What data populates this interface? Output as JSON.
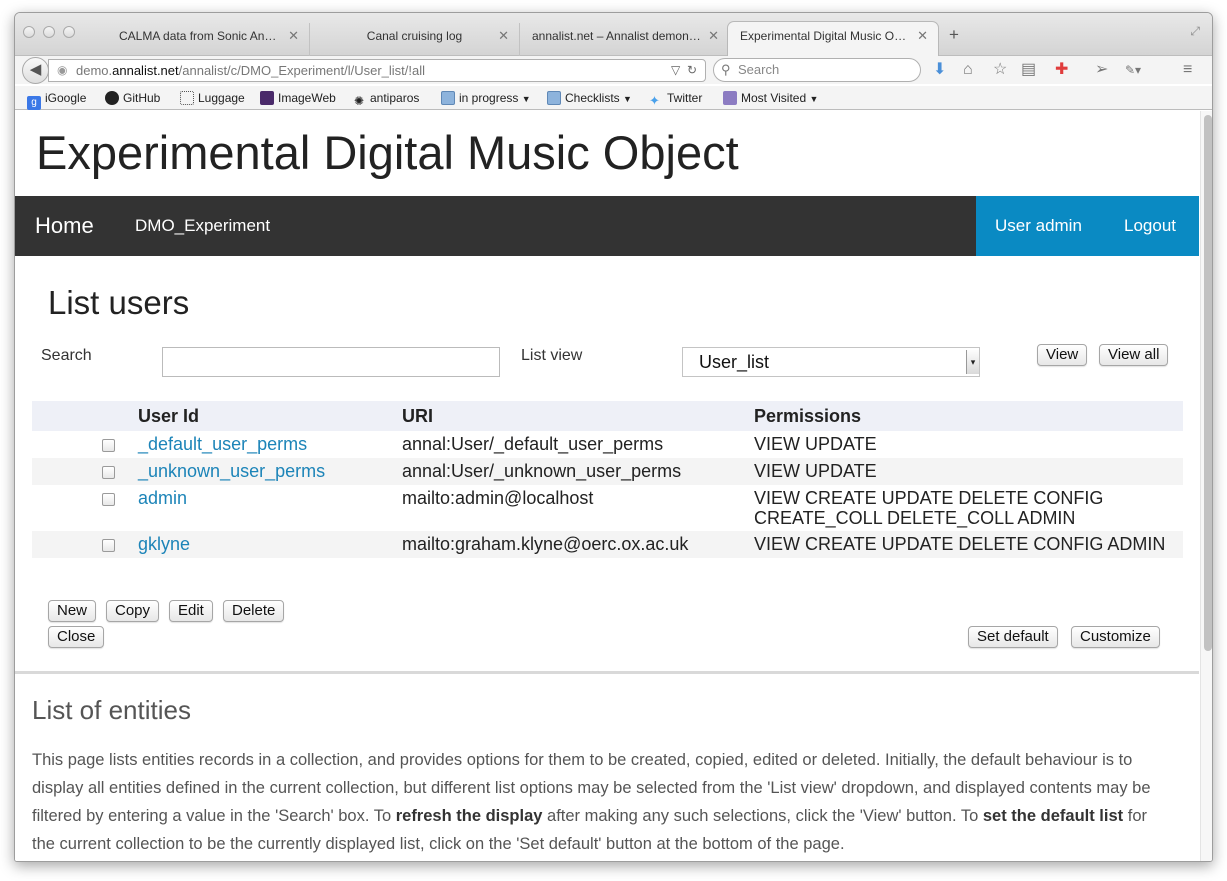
{
  "browser": {
    "tabs": [
      {
        "label": "CALMA data from Sonic Annot…"
      },
      {
        "label": "Canal cruising log"
      },
      {
        "label": "annalist.net – Annalist demon…"
      },
      {
        "label": "Experimental Digital Music Ob…"
      }
    ],
    "new_tab": "+",
    "url_prefix": "demo.",
    "url_host": "annalist.net",
    "url_path": "/annalist/c/DMO_Experiment/l/User_list/!all",
    "search_placeholder": "Search",
    "bookmarks": [
      {
        "label": "iGoogle",
        "icon": "google-icon"
      },
      {
        "label": "GitHub",
        "icon": "github-icon"
      },
      {
        "label": "Luggage",
        "icon": "dotted-box-icon"
      },
      {
        "label": "ImageWeb",
        "icon": "imageweb-icon"
      },
      {
        "label": "antiparos",
        "icon": "gear-icon"
      },
      {
        "label": "in progress",
        "icon": "folder-icon",
        "dropdown": true
      },
      {
        "label": "Checklists",
        "icon": "folder-icon",
        "dropdown": true
      },
      {
        "label": "Twitter",
        "icon": "twitter-icon"
      },
      {
        "label": "Most Visited",
        "icon": "most-visited-icon",
        "dropdown": true
      }
    ]
  },
  "site": {
    "title": "Experimental Digital Music Object",
    "nav": {
      "home": "Home",
      "collection": "DMO_Experiment",
      "user_admin": "User admin",
      "logout": "Logout"
    }
  },
  "page": {
    "heading": "List users",
    "search_label": "Search",
    "search_value": "",
    "list_view_label": "List view",
    "list_view_selected": "User_list",
    "view_button": "View",
    "view_all_button": "View all",
    "table": {
      "columns": [
        "User Id",
        "URI",
        "Permissions"
      ],
      "rows": [
        {
          "id": "_default_user_perms",
          "uri": "annal:User/_default_user_perms",
          "permissions": "VIEW UPDATE"
        },
        {
          "id": "_unknown_user_perms",
          "uri": "annal:User/_unknown_user_perms",
          "permissions": "VIEW UPDATE"
        },
        {
          "id": "admin",
          "uri": "mailto:admin@localhost",
          "permissions": "VIEW CREATE UPDATE DELETE CONFIG CREATE_COLL DELETE_COLL ADMIN"
        },
        {
          "id": "gklyne",
          "uri": "mailto:graham.klyne@oerc.ox.ac.uk",
          "permissions": "VIEW CREATE UPDATE DELETE CONFIG ADMIN"
        }
      ]
    },
    "buttons": {
      "new": "New",
      "copy": "Copy",
      "edit": "Edit",
      "delete": "Delete",
      "close": "Close",
      "set_default": "Set default",
      "customize": "Customize"
    }
  },
  "help": {
    "heading": "List of entities",
    "p1": "This page lists entities records in a collection, and provides options for them to be created, copied, edited or deleted. Initially, the default behaviour is to display all entities defined in the current collection, but different list options may be selected from the 'List view' dropdown, and displayed contents may be filtered by entering a value in the 'Search' box. To ",
    "b1": "refresh the display",
    "p2": " after making any such selections, click the 'View' button. To ",
    "b2": "set the default list",
    "p3": " for the current collection to be the currently displayed list, click on the 'Set default' button at the bottom of the page."
  },
  "colors": {
    "nav_bg": "#333333",
    "admin_bg": "#0a8ac3",
    "link": "#1c84b8",
    "table_header_bg": "#eef0f7"
  }
}
